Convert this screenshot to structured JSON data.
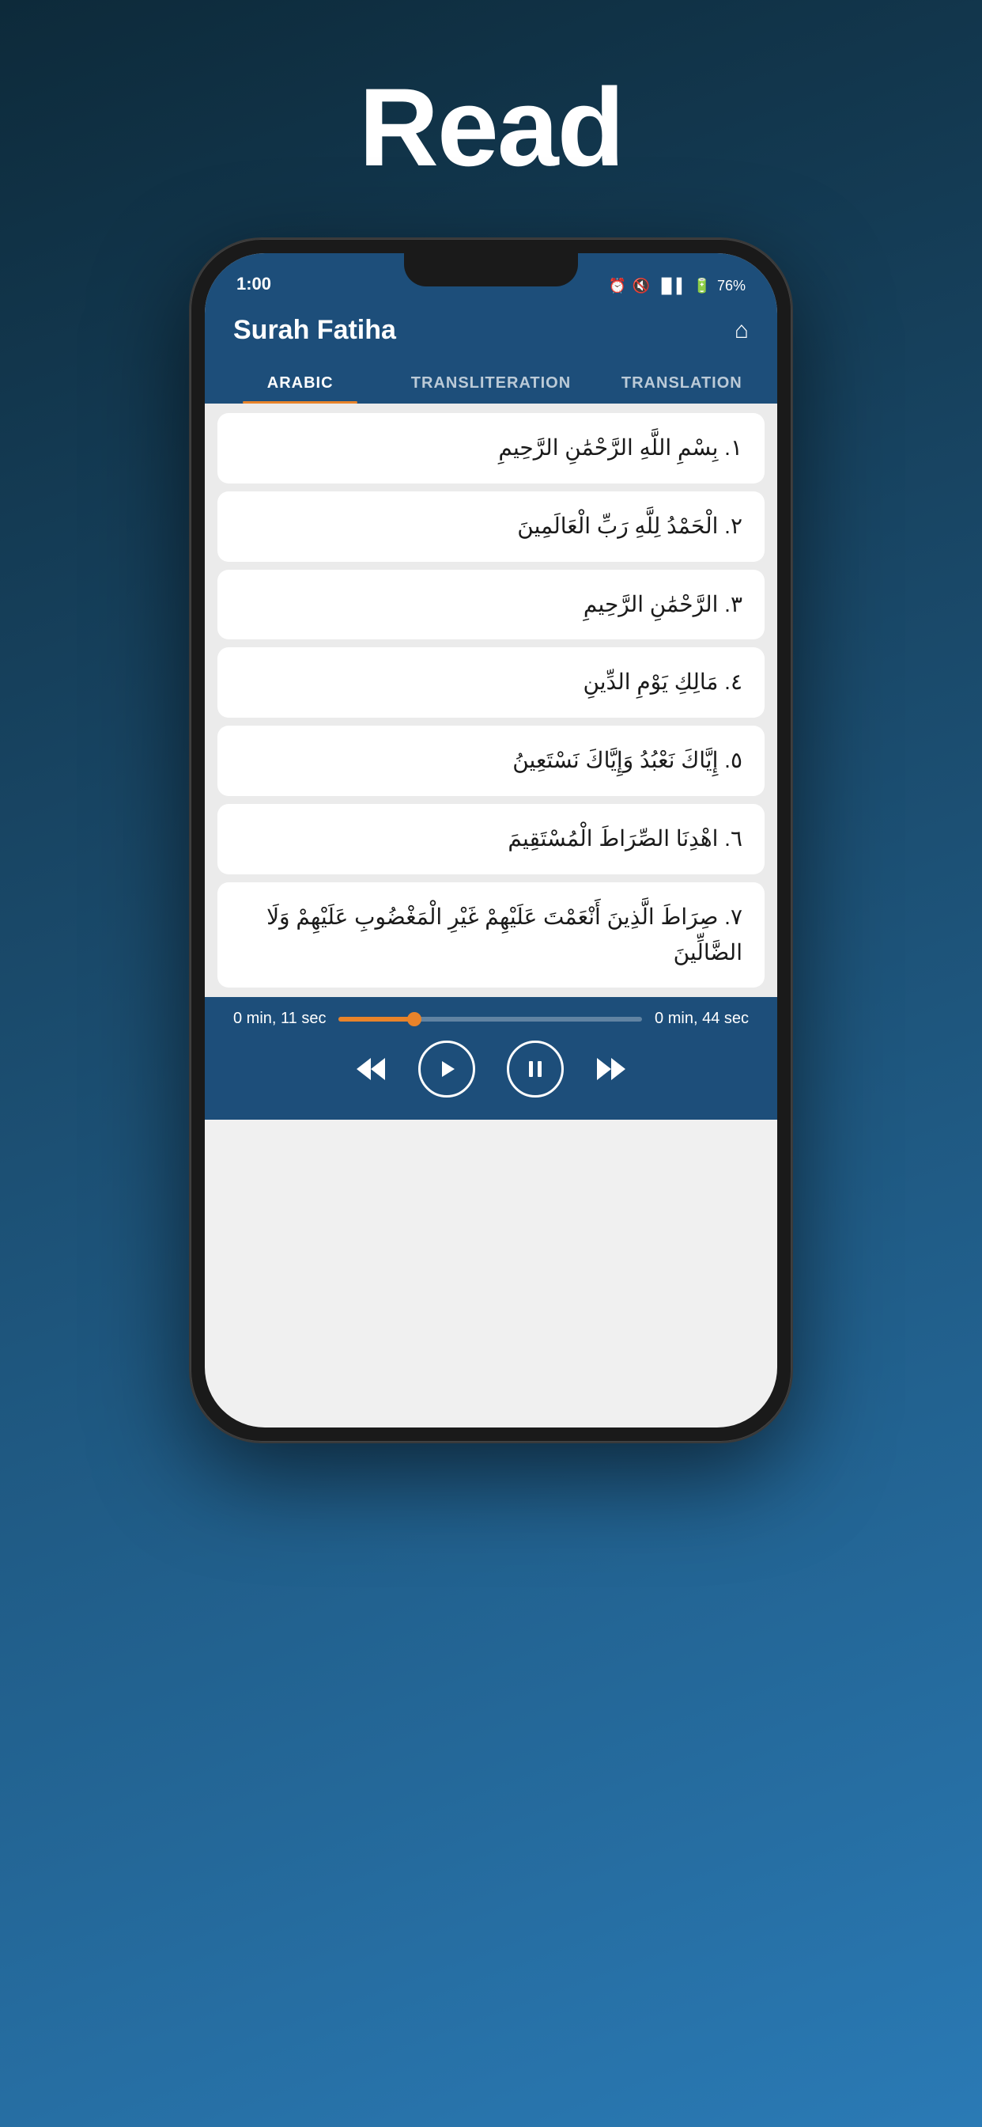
{
  "page": {
    "title": "Read",
    "background_top": "#0d2a3a",
    "background_bottom": "#2a7ab5"
  },
  "status_bar": {
    "time": "1:00",
    "battery": "76%",
    "icons": "⏰ 🔇 📶 🔋"
  },
  "app_header": {
    "title": "Surah Fatiha",
    "home_icon": "⌂"
  },
  "tabs": [
    {
      "id": "arabic",
      "label": "ARABIC",
      "active": true
    },
    {
      "id": "transliteration",
      "label": "TRANSLITERATION",
      "active": false
    },
    {
      "id": "translation",
      "label": "TRANSLATION",
      "active": false
    }
  ],
  "verses": [
    {
      "number": "١.",
      "text": "بِسْمِ اللَّهِ الرَّحْمَٰنِ الرَّحِيمِ"
    },
    {
      "number": "٢.",
      "text": "الْحَمْدُ لِلَّهِ رَبِّ الْعَالَمِينَ"
    },
    {
      "number": "٣.",
      "text": "الرَّحْمَٰنِ الرَّحِيمِ"
    },
    {
      "number": "٤.",
      "text": "مَالِكِ يَوْمِ الدِّينِ"
    },
    {
      "number": "٥.",
      "text": "إِيَّاكَ نَعْبُدُ وَإِيَّاكَ نَسْتَعِينُ"
    },
    {
      "number": "٦.",
      "text": "اهْدِنَا الصِّرَاطَ الْمُسْتَقِيمَ"
    },
    {
      "number": "٧.",
      "text": "صِرَاطَ الَّذِينَ أَنْعَمْتَ عَلَيْهِمْ غَيْرِ الْمَغْضُوبِ عَلَيْهِمْ وَلَا الضَّالِّينَ"
    }
  ],
  "player": {
    "time_current": "0 min, 11 sec",
    "time_total": "0 min, 44 sec",
    "progress_percent": 25
  }
}
